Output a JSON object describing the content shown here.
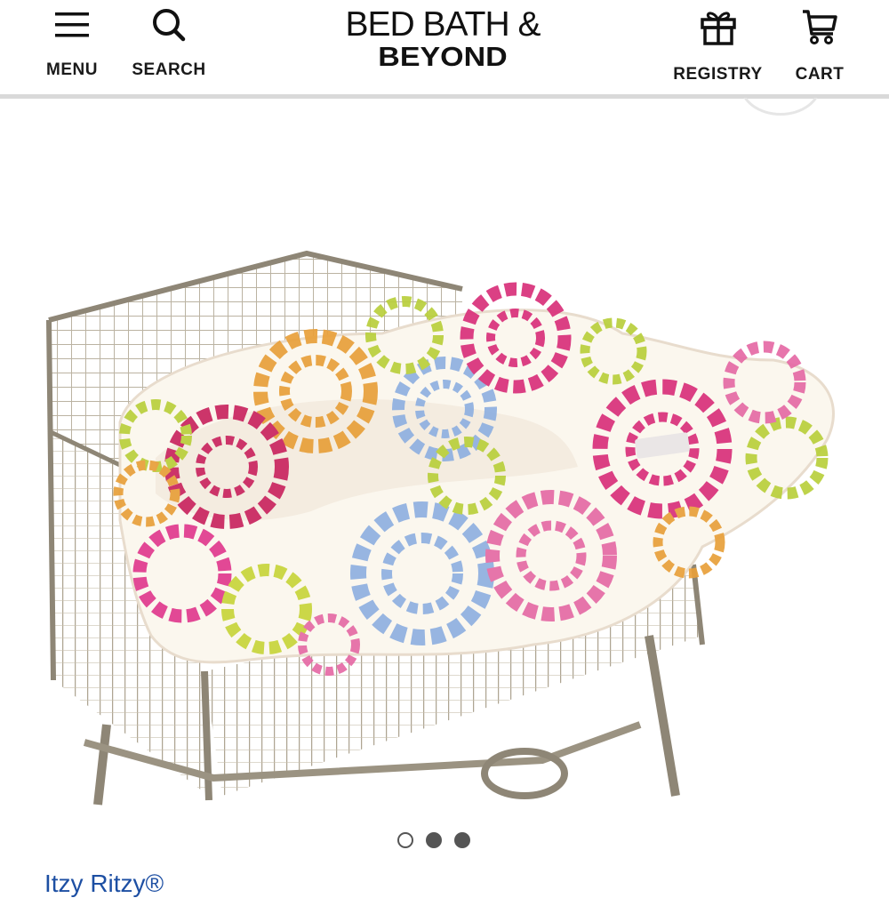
{
  "header": {
    "menu_label": "MENU",
    "search_label": "SEARCH",
    "registry_label": "REGISTRY",
    "cart_label": "CART",
    "logo_line1": "BED BATH &",
    "logo_line2": "BEYOND",
    "icons": {
      "menu": "hamburger-icon",
      "search": "search-icon",
      "registry": "gift-icon",
      "cart": "cart-icon"
    }
  },
  "product": {
    "image_alt": "Shopping cart with floral cover",
    "carousel": {
      "count": 3,
      "active_index": 0
    },
    "brand": "Itzy Ritzy®"
  },
  "colors": {
    "brand_link": "#1d4fa3",
    "header_divider": "#d9d9d9",
    "dot": "#555555"
  }
}
